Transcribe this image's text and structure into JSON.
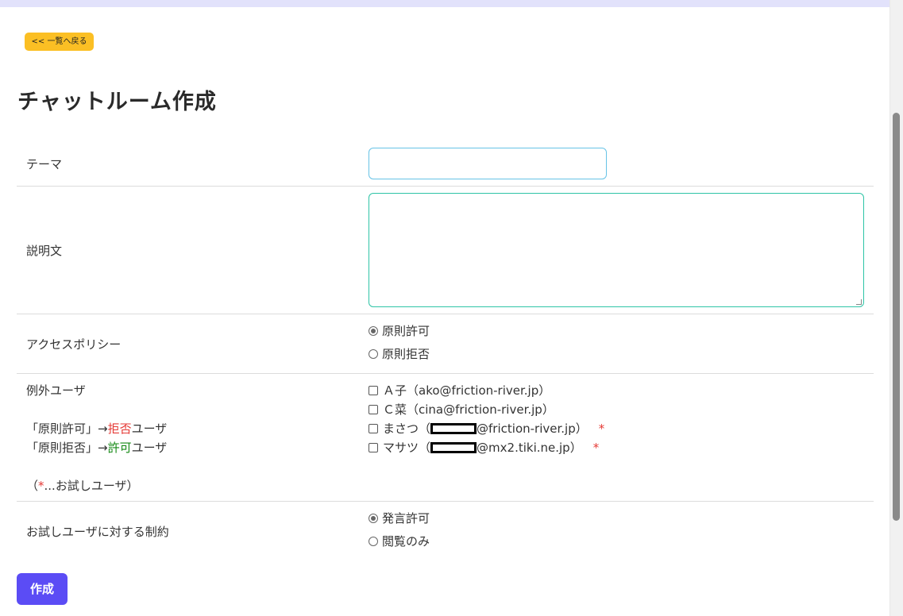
{
  "back_button": "<< 一覧へ戻る",
  "page_title": "チャットルーム作成",
  "form": {
    "theme": {
      "label": "テーマ",
      "value": ""
    },
    "description": {
      "label": "説明文",
      "value": ""
    },
    "access_policy": {
      "label": "アクセスポリシー",
      "options": [
        {
          "label": "原則許可",
          "selected": true
        },
        {
          "label": "原則拒否",
          "selected": false
        }
      ]
    },
    "exceptions": {
      "label": "例外ユーザ",
      "note1_prefix": "「原則許可」→",
      "note1_emph": "拒否",
      "note1_suffix": "ユーザ",
      "note2_prefix": "「原則拒否」→",
      "note2_emph": "許可",
      "note2_suffix": "ユーザ",
      "legend_open": "（",
      "legend_star": "*",
      "legend_text": "...お試しユーザ）",
      "users": [
        {
          "name": "Ａ子",
          "email": "（ako@friction-river.jp）",
          "checked": false
        },
        {
          "name": "Ｃ菜",
          "email": "（cina@friction-river.jp）",
          "checked": false
        },
        {
          "name": "まさつ",
          "email_prefix": "（",
          "email_domain": "@friction-river.jp）",
          "checked": false,
          "trial": "*"
        },
        {
          "name": "マサツ",
          "email_prefix": "（",
          "email_domain": "@mx2.tiki.ne.jp）",
          "checked": false,
          "trial": "*"
        }
      ]
    },
    "trial_restriction": {
      "label": "お試しユーザに対する制約",
      "options": [
        {
          "label": "発言許可",
          "selected": true
        },
        {
          "label": "閲覧のみ",
          "selected": false
        }
      ]
    }
  },
  "submit_button": "作成",
  "colors": {
    "accent": "#5b4cf5",
    "back_button": "#fbbf24",
    "deny": "#e53935",
    "allow": "#168a16"
  }
}
